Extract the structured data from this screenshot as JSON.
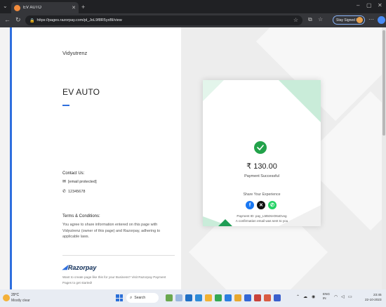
{
  "browser": {
    "tab_title": "EV AUTO",
    "url": "https://pages.razorpay.com/pl_JoL9f8R5yxBl/view",
    "signed_in_label": "Stay Signed In"
  },
  "page": {
    "merchant_name": "Vidyutrenz",
    "title": "EV AUTO",
    "contact": {
      "heading": "Contact Us:",
      "email": "[email protected]",
      "phone": "12345678"
    },
    "terms": {
      "heading": "Terms & Conditions:",
      "text": "You agree to share information entered on this page with Vidyutrenz (owner of this page) and Razorpay, adhering to applicable laws."
    },
    "powered_by": "Razorpay",
    "footer_text": "Want to create page like this for your Business? Visit Razorpay Payment Pages to get started!"
  },
  "receipt": {
    "amount": "₹ 130.00",
    "status": "Payment Successful",
    "share_label": "Share Your Experience",
    "payment_id": "Payment ID: pay_L5t5tXeO6xDvvg",
    "confirmation": "A confirmation email was sent to you"
  },
  "taskbar": {
    "weather_temp": "29°C",
    "weather_desc": "Mostly clear",
    "search_label": "Search",
    "lang_top": "ENG",
    "lang_bottom": "IN",
    "time": "23:45",
    "date": "22-10-2023"
  },
  "colors": {
    "accent": "#2f6fde",
    "success": "#22a24a",
    "facebook": "#1877f2",
    "x": "#111111",
    "whatsapp": "#25d366"
  },
  "icons": {
    "check": "check-icon",
    "email": "mail-icon",
    "phone": "phone-icon",
    "facebook": "facebook-icon",
    "x": "x-icon",
    "whatsapp": "whatsapp-icon"
  }
}
